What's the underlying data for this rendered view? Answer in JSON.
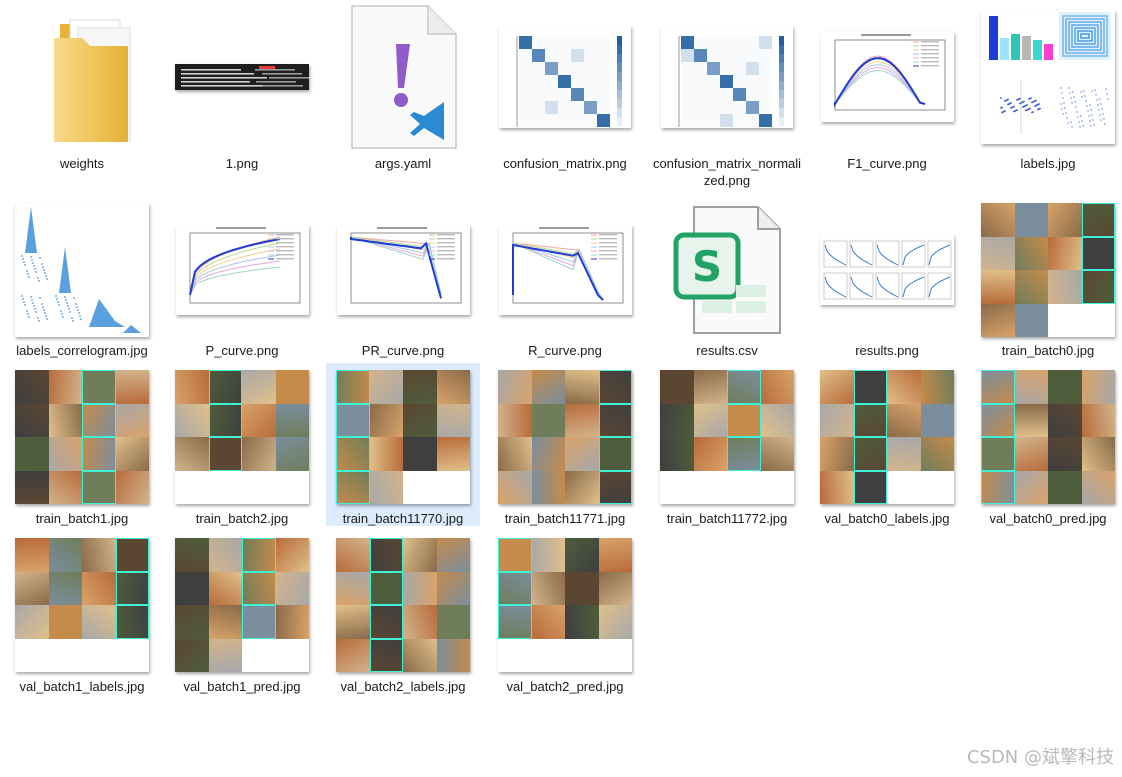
{
  "files": [
    {
      "name": "weights",
      "kind": "folder",
      "icon": "folder-icon"
    },
    {
      "name": "1.png",
      "kind": "strip",
      "icon": "terminal-screenshot-icon"
    },
    {
      "name": "args.yaml",
      "kind": "yaml",
      "icon": "yaml-file-icon"
    },
    {
      "name": "confusion_matrix.png",
      "kind": "matrix",
      "icon": "confusion-matrix-thumbnail"
    },
    {
      "name": "confusion_matrix_normalized.png",
      "kind": "matrix",
      "icon": "confusion-matrix-thumbnail"
    },
    {
      "name": "F1_curve.png",
      "kind": "curve",
      "icon": "f1-curve-thumbnail"
    },
    {
      "name": "labels.jpg",
      "kind": "labels",
      "icon": "labels-plot-thumbnail"
    },
    {
      "name": "labels_correlogram.jpg",
      "kind": "correlogram",
      "icon": "correlogram-thumbnail"
    },
    {
      "name": "P_curve.png",
      "kind": "curve",
      "icon": "p-curve-thumbnail"
    },
    {
      "name": "PR_curve.png",
      "kind": "curve",
      "icon": "pr-curve-thumbnail"
    },
    {
      "name": "R_curve.png",
      "kind": "curve",
      "icon": "r-curve-thumbnail"
    },
    {
      "name": "results.csv",
      "kind": "csv",
      "icon": "spreadsheet-file-icon",
      "glyph": "S"
    },
    {
      "name": "results.png",
      "kind": "results",
      "icon": "results-plots-thumbnail"
    },
    {
      "name": "train_batch0.jpg",
      "kind": "mosaic",
      "icon": "image-mosaic-thumbnail"
    },
    {
      "name": "train_batch1.jpg",
      "kind": "mosaic",
      "icon": "image-mosaic-thumbnail"
    },
    {
      "name": "train_batch2.jpg",
      "kind": "mosaic",
      "icon": "image-mosaic-thumbnail"
    },
    {
      "name": "train_batch11770.jpg",
      "kind": "mosaic",
      "icon": "image-mosaic-thumbnail",
      "selected": true
    },
    {
      "name": "train_batch11771.jpg",
      "kind": "mosaic",
      "icon": "image-mosaic-thumbnail"
    },
    {
      "name": "train_batch11772.jpg",
      "kind": "mosaic",
      "icon": "image-mosaic-thumbnail"
    },
    {
      "name": "val_batch0_labels.jpg",
      "kind": "mosaic",
      "icon": "image-mosaic-thumbnail"
    },
    {
      "name": "val_batch0_pred.jpg",
      "kind": "mosaic",
      "icon": "image-mosaic-thumbnail"
    },
    {
      "name": "val_batch1_labels.jpg",
      "kind": "mosaic",
      "icon": "image-mosaic-thumbnail"
    },
    {
      "name": "val_batch1_pred.jpg",
      "kind": "mosaic",
      "icon": "image-mosaic-thumbnail"
    },
    {
      "name": "val_batch2_labels.jpg",
      "kind": "mosaic",
      "icon": "image-mosaic-thumbnail"
    },
    {
      "name": "val_batch2_pred.jpg",
      "kind": "mosaic",
      "icon": "image-mosaic-thumbnail"
    }
  ],
  "watermark": "CSDN @斌擎科技",
  "colors": {
    "selection": "#dcecfc",
    "folder": "#f5c64a",
    "yaml_mark": "#8e5bc9",
    "vscode_blue": "#2a8ad4",
    "csv_green": "#21a366",
    "matrix_blue": "#1f5fa0",
    "mosaic_palette": [
      "#c58b4a",
      "#8a6a48",
      "#3f3f3f",
      "#d9a36a",
      "#6f7d5a",
      "#a8a8a8",
      "#5b4632",
      "#e0c08a",
      "#7a8e9e",
      "#b86b3a",
      "#4e5d3c",
      "#d2b48c"
    ]
  }
}
